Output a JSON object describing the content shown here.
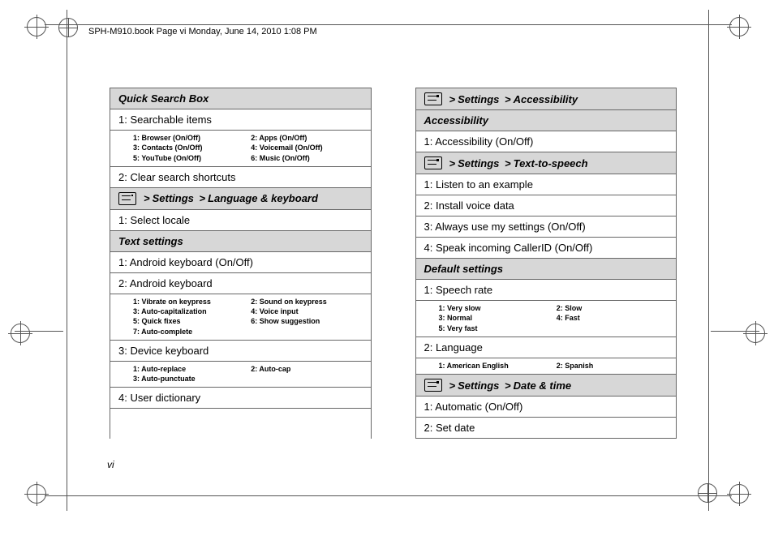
{
  "header": "SPH-M910.book  Page vi  Monday, June 14, 2010  1:08 PM",
  "page_number": "vi",
  "gt": ">",
  "settings_label": "Settings",
  "qsb": {
    "title": "Quick Search Box",
    "items": {
      "i1": "1: Searchable items",
      "i2": "2: Clear search shortcuts"
    },
    "sub1": {
      "a": "1: Browser (On/Off)",
      "b": "2: Apps (On/Off)",
      "c": "3: Contacts (On/Off)",
      "d": "4: Voicemail (On/Off)",
      "e": "5: YouTube (On/Off)",
      "f": "6: Music (On/Off)"
    }
  },
  "lang_kb": {
    "crumb": "Language & keyboard",
    "i1": "1: Select locale",
    "text_settings": "Text settings",
    "t1": "1: Android keyboard (On/Off)",
    "t2": "2: Android keyboard",
    "t2_sub": {
      "a": "1: Vibrate on keypress",
      "b": "2: Sound on keypress",
      "c": "3: Auto-capitalization",
      "d": "4: Voice input",
      "e": "5: Quick fixes",
      "f": "6: Show suggestion",
      "g": "7: Auto-complete"
    },
    "t3": "3: Device keyboard",
    "t3_sub": {
      "a": "1: Auto-replace",
      "b": "2: Auto-cap",
      "c": "3: Auto-punctuate"
    },
    "t4": "4: User dictionary"
  },
  "access": {
    "crumb": "Accessibility",
    "section": "Accessibility",
    "i1": "1: Accessibility (On/Off)"
  },
  "tts": {
    "crumb": "Text-to-speech",
    "i1": "1: Listen to an example",
    "i2": "2: Install voice data",
    "i3": "3: Always use my settings (On/Off)",
    "i4": "4: Speak incoming CallerID (On/Off)",
    "defaults": "Default settings",
    "d1": "1: Speech rate",
    "d1_sub": {
      "a": "1: Very slow",
      "b": "2: Slow",
      "c": "3: Normal",
      "d": "4: Fast",
      "e": "5: Very fast"
    },
    "d2": "2: Language",
    "d2_sub": {
      "a": "1: American English",
      "b": "2: Spanish"
    }
  },
  "datetime": {
    "crumb": "Date & time",
    "i1": "1: Automatic (On/Off)",
    "i2": "2: Set date"
  }
}
